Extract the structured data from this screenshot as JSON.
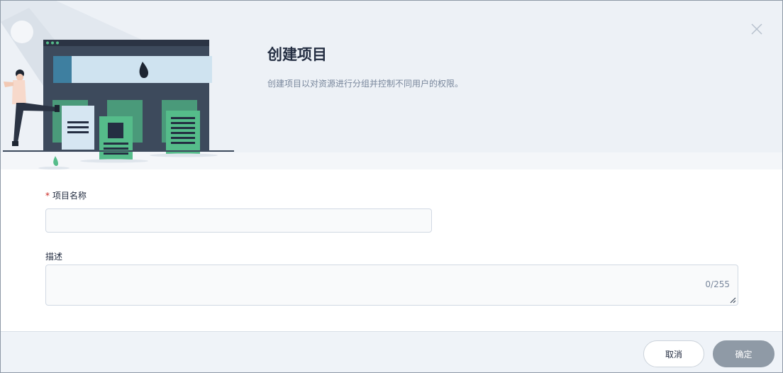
{
  "dialog": {
    "title": "创建项目",
    "subtitle": "创建项目以对资源进行分组并控制不同用户的权限。"
  },
  "form": {
    "name_label": "项目名称",
    "required_mark": "*",
    "name_value": "",
    "description_label": "描述",
    "description_value": "",
    "description_counter": "0/255"
  },
  "footer": {
    "cancel_label": "取消",
    "confirm_label": "确定"
  },
  "icons": {
    "close": "close-icon",
    "resize": "resize-handle-icon"
  },
  "colors": {
    "title": "#242e42",
    "required": "#ca2621",
    "confirm_disabled": "#8f9aa6",
    "illustration_green": "#55bc8a"
  }
}
